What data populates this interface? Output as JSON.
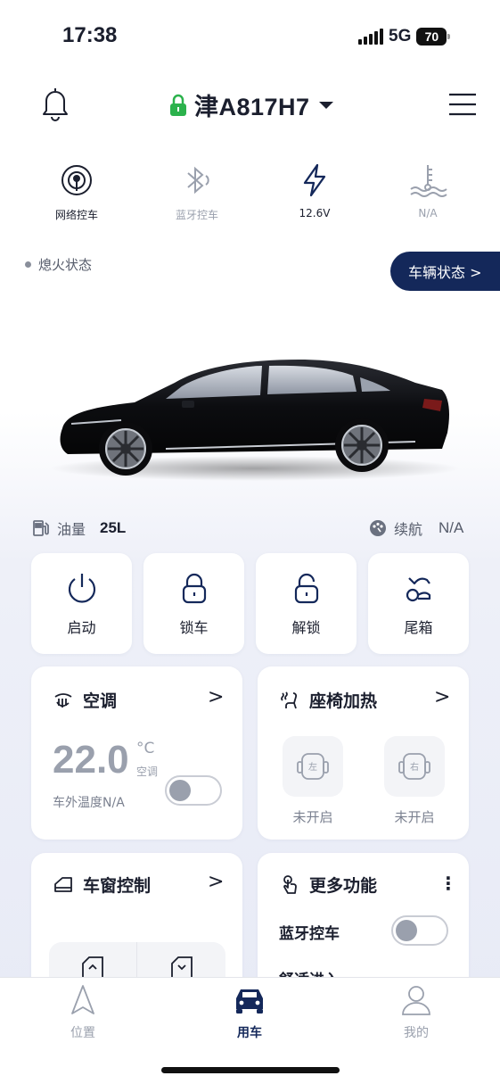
{
  "status_bar": {
    "time": "17:38",
    "network": "5G",
    "battery": "70"
  },
  "header": {
    "plate": "津A817H7"
  },
  "quick_status": [
    {
      "label": "网络控车",
      "icon": "network-control-icon"
    },
    {
      "label": "蓝牙控车",
      "icon": "bluetooth-icon"
    },
    {
      "label": "12.6V",
      "icon": "voltage-icon"
    },
    {
      "label": "N/A",
      "icon": "coolant-temp-icon"
    }
  ],
  "ignition": {
    "label": "熄火状态"
  },
  "vehicle_status_button": "车辆状态 >",
  "fuel": {
    "label": "油量",
    "value": "25L"
  },
  "range": {
    "label": "续航",
    "value": "N/A"
  },
  "actions": [
    {
      "label": "启动",
      "icon": "power-icon"
    },
    {
      "label": "锁车",
      "icon": "lock-icon"
    },
    {
      "label": "解锁",
      "icon": "unlock-icon"
    },
    {
      "label": "尾箱",
      "icon": "trunk-icon"
    }
  ],
  "ac_card": {
    "title": "空调",
    "chevron": ">",
    "temp": "22.0",
    "unit": "°C",
    "unit_sub": "空调",
    "outside": "车外温度N/A",
    "toggle_on": false
  },
  "seat_card": {
    "title": "座椅加热",
    "chevron": ">",
    "seats": [
      {
        "mark": "左",
        "status": "未开启"
      },
      {
        "mark": "右",
        "status": "未开启"
      }
    ]
  },
  "window_card": {
    "title": "车窗控制",
    "chevron": ">"
  },
  "more_card": {
    "title": "更多功能",
    "more": "⋮",
    "rows": [
      {
        "label": "蓝牙控车",
        "on": false
      },
      {
        "label": "舒适进入",
        "on": true
      }
    ]
  },
  "bottom_nav": [
    {
      "label": "位置",
      "active": false
    },
    {
      "label": "用车",
      "active": true
    },
    {
      "label": "我的",
      "active": false
    }
  ],
  "colors": {
    "brand": "#14285a",
    "lock_green": "#2bb24c",
    "muted": "#9aa0ad"
  }
}
